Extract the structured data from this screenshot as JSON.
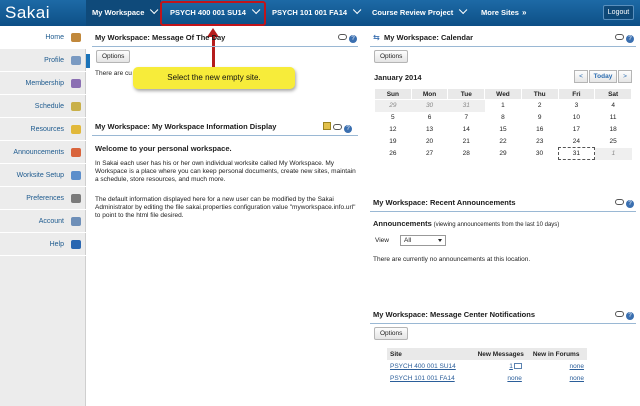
{
  "brand": "Sakai",
  "topnav": {
    "tabs": [
      "My Workspace",
      "PSYCH 400 001 SU14",
      "PSYCH 101 001 FA14",
      "Course Review Project",
      "More Sites"
    ],
    "logout": "Logout"
  },
  "sidebar": {
    "items": [
      {
        "label": "Home",
        "icon": "home-icon",
        "color": "#c1883b"
      },
      {
        "label": "Profile",
        "icon": "profile-icon",
        "color": "#7a9ac2"
      },
      {
        "label": "Membership",
        "icon": "membership-icon",
        "color": "#8b6fb3"
      },
      {
        "label": "Schedule",
        "icon": "schedule-icon",
        "color": "#c9b049"
      },
      {
        "label": "Resources",
        "icon": "folder-icon",
        "color": "#e1b83a"
      },
      {
        "label": "Announcements",
        "icon": "megaphone-icon",
        "color": "#d9643c"
      },
      {
        "label": "Worksite Setup",
        "icon": "setup-icon",
        "color": "#5c8ecb"
      },
      {
        "label": "Preferences",
        "icon": "preferences-icon",
        "color": "#7b7b7b"
      },
      {
        "label": "Account",
        "icon": "account-icon",
        "color": "#6e8fb8"
      },
      {
        "label": "Help",
        "icon": "help-icon",
        "color": "#2a67b1"
      }
    ]
  },
  "callout": "Select the new empty site.",
  "motd": {
    "title": "My Workspace: Message Of The Day",
    "options_label": "Options",
    "body": "There are cu"
  },
  "info_display": {
    "title": "My Workspace: My Workspace Information Display",
    "heading": "Welcome to your personal workspace.",
    "p1": "In Sakai each user has his or her own individual worksite called My Workspace. My Workspace is a place where you can keep personal documents, create new sites, maintain a schedule, store resources, and much more.",
    "p2": "The default information displayed here for a new user can be modified by the Sakai Administrator by editing the file sakai.properties configuration value \"myworkspace.info.url\" to point to the html file desired."
  },
  "calendar": {
    "title": "My Workspace: Calendar",
    "options_label": "Options",
    "month": "January 2014",
    "today_label": "Today",
    "prev_label": "<",
    "next_label": ">",
    "days": [
      "Sun",
      "Mon",
      "Tue",
      "Wed",
      "Thu",
      "Fri",
      "Sat"
    ],
    "weeks": [
      [
        "29",
        "30",
        "31",
        "1",
        "2",
        "3",
        "4"
      ],
      [
        "5",
        "6",
        "7",
        "8",
        "9",
        "10",
        "11"
      ],
      [
        "12",
        "13",
        "14",
        "15",
        "16",
        "17",
        "18"
      ],
      [
        "19",
        "20",
        "21",
        "22",
        "23",
        "24",
        "25"
      ],
      [
        "26",
        "27",
        "28",
        "29",
        "30",
        "31",
        "1"
      ]
    ],
    "other_month_cells": [
      "0-0",
      "0-1",
      "0-2",
      "4-6"
    ],
    "today_cell": "4-5"
  },
  "announcements": {
    "title": "My Workspace: Recent Announcements",
    "heading": "Announcements",
    "subheading": "(viewing announcements from the last 10 days)",
    "view_label": "View",
    "view_value": "All",
    "empty": "There are currently no announcements at this location."
  },
  "message_center": {
    "title": "My Workspace: Message Center Notifications",
    "options_label": "Options",
    "headers": [
      "Site",
      "New Messages",
      "New in Forums"
    ],
    "rows": [
      {
        "site": "PSYCH 400 001 SU14",
        "messages": "1",
        "forums": "none"
      },
      {
        "site": "PSYCH 101 001 FA14",
        "messages": "none",
        "forums": "none"
      }
    ]
  }
}
